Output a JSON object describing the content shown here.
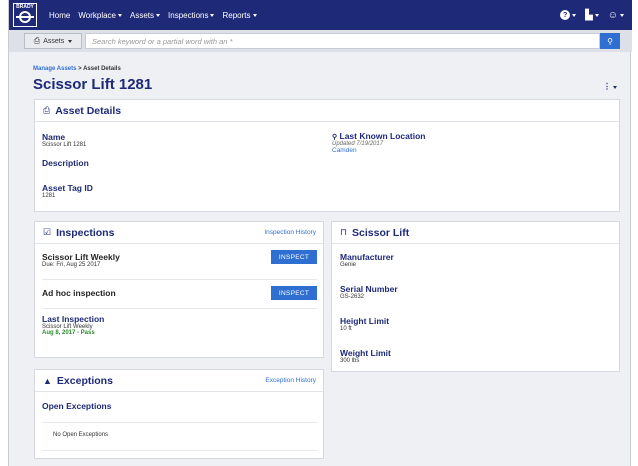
{
  "nav": {
    "logo_text": "BRADY",
    "items": [
      {
        "label": "Home"
      },
      {
        "label": "Workplace"
      },
      {
        "label": "Assets"
      },
      {
        "label": "Inspections"
      },
      {
        "label": "Reports"
      }
    ],
    "help_glyph": "?",
    "chart_glyph": "▙",
    "user_glyph": "☺"
  },
  "search": {
    "scope_label": "Assets",
    "placeholder": "Search keyword or a partial word with an *",
    "button_glyph": "⚲"
  },
  "breadcrumb": {
    "link": "Manage Assets",
    "separator": " > ",
    "current": "Asset Details"
  },
  "page": {
    "title": "Scissor Lift 1281",
    "menu_glyph": "⋮"
  },
  "asset_details": {
    "title": "Asset Details",
    "name_label": "Name",
    "name_value": "Scissor Lift 1281",
    "description_label": "Description",
    "tag_label": "Asset Tag ID",
    "tag_value": "1281",
    "location_label": "Last Known Location",
    "location_updated": "Updated 7/19/2017",
    "location_value": "Camden"
  },
  "inspections": {
    "title": "Inspections",
    "history_link": "Inspection History",
    "items": [
      {
        "name": "Scissor Lift Weekly",
        "due": "Due: Fri, Aug 25 2017",
        "button": "INSPECT"
      },
      {
        "name": "Ad hoc inspection",
        "button": "INSPECT"
      }
    ],
    "last_label": "Last Inspection",
    "last_name": "Scissor Lift Weekly",
    "last_result": "Aug 8, 2017 - Pass"
  },
  "scissor_lift": {
    "title": "Scissor Lift",
    "fields": [
      {
        "label": "Manufacturer",
        "value": "Genie"
      },
      {
        "label": "Serial Number",
        "value": "GS-2632"
      },
      {
        "label": "Height Limit",
        "value": "10 ft"
      },
      {
        "label": "Weight Limit",
        "value": "300 lbs"
      }
    ]
  },
  "exceptions": {
    "title": "Exceptions",
    "history_link": "Exception History",
    "open_label": "Open Exceptions",
    "empty_text": "No Open Exceptions"
  },
  "colors": {
    "navbar": "#1e2a78",
    "accent": "#2f6fd1",
    "pass": "#2a8a2a"
  }
}
